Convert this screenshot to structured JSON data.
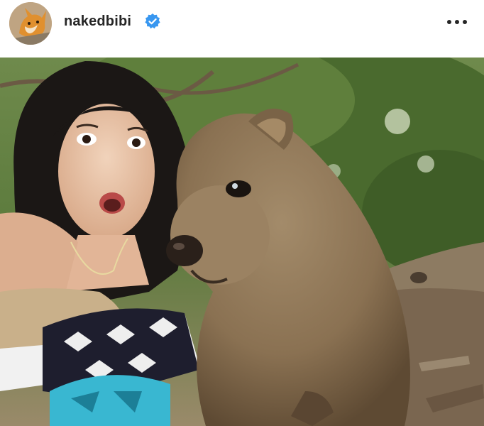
{
  "post": {
    "username": "nakedbibi",
    "verified": true,
    "avatar_icon": "cat-avatar",
    "more_icon": "more-options-icon",
    "photo_description": ""
  },
  "colors": {
    "text": "#262626",
    "verified_blue": "#3897f0",
    "background": "#ffffff"
  }
}
